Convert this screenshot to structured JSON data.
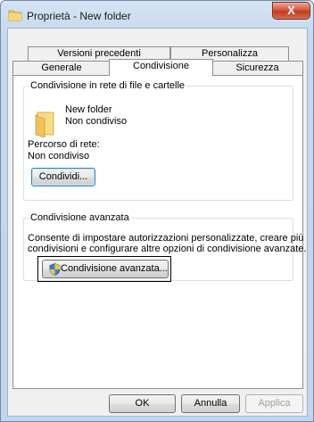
{
  "window": {
    "title": "Proprietà - New folder",
    "close_label": "X"
  },
  "tabs": {
    "row1": [
      "Versioni precedenti",
      "Personalizza"
    ],
    "row2": [
      "Generale",
      "Condivisione",
      "Sicurezza"
    ],
    "selected": "Condivisione"
  },
  "sharing": {
    "group_title": "Condivisione in rete di file e cartelle",
    "folder_name": "New folder",
    "folder_status": "Non condiviso",
    "network_path_label": "Percorso di rete:",
    "network_path_value": "Non condiviso",
    "share_button": "Condividi..."
  },
  "advanced": {
    "group_title": "Condivisione avanzata",
    "description_line1": "Consente di impostare autorizzazioni personalizzate, creare più",
    "description_line2": "condivisioni e configurare altre opzioni di condivisione avanzate.",
    "button": "Condivisione avanzata..."
  },
  "footer": {
    "ok": "OK",
    "cancel": "Annulla",
    "apply": "Applica"
  },
  "icons": {
    "title": "folder-icon",
    "close": "close-icon",
    "folder": "folder-icon",
    "uac": "shield-icon"
  }
}
